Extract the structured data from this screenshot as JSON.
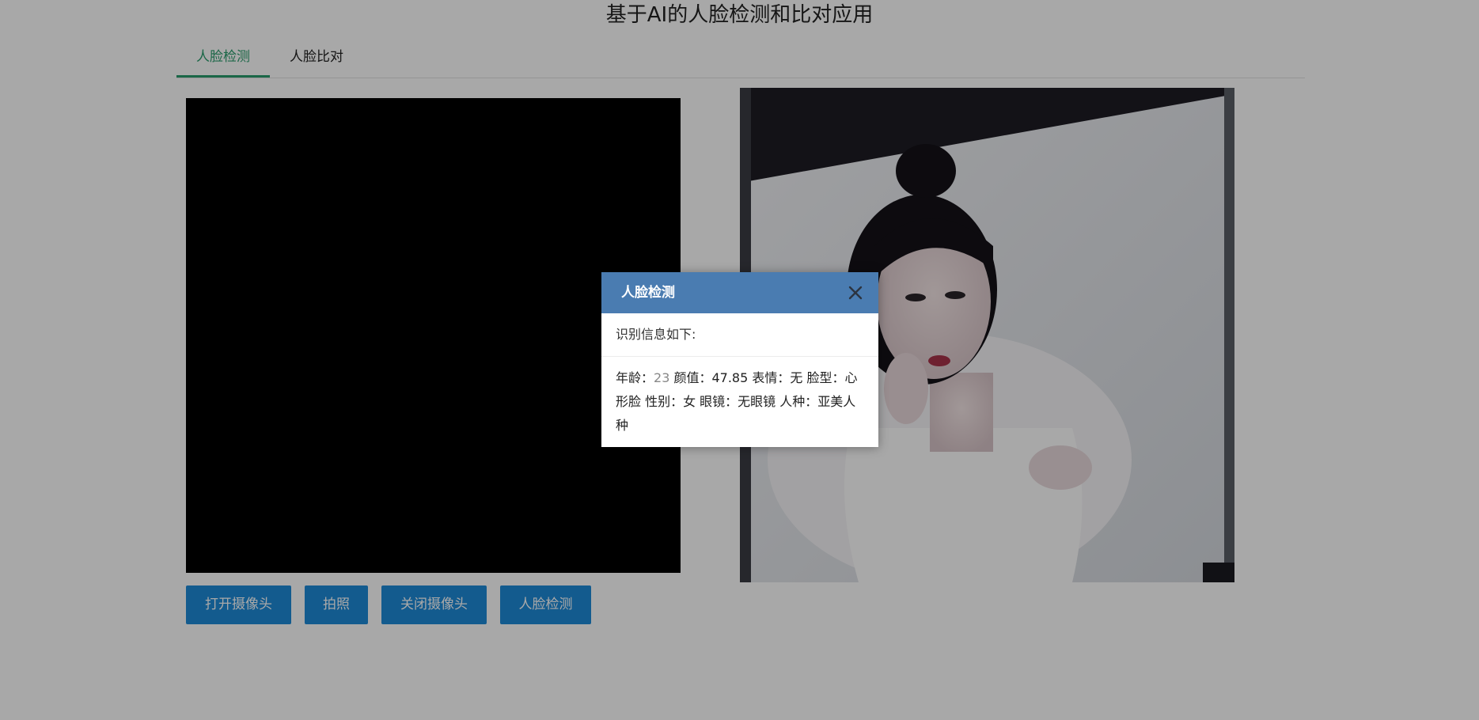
{
  "page_title": "基于AI的人脸检测和比对应用",
  "tabs": [
    {
      "label": "人脸检测",
      "active": true
    },
    {
      "label": "人脸比对",
      "active": false
    }
  ],
  "buttons": {
    "open_camera": "打开摄像头",
    "snapshot": "拍照",
    "close_camera": "关闭摄像头",
    "detect": "人脸检测"
  },
  "dialog": {
    "title": "人脸检测",
    "close_icon": "close-icon",
    "subtitle": "识别信息如下:",
    "result": {
      "age_label": "年龄：",
      "age_value": "23",
      "rest": " 颜值：47.85 表情：无 脸型：心形脸 性别：女 眼镜：无眼镜 人种：亚美人种"
    }
  },
  "colors": {
    "accent_tab": "#2a9d6c",
    "button_blue": "#1e8ad8",
    "dialog_header": "#4a7cb1"
  }
}
